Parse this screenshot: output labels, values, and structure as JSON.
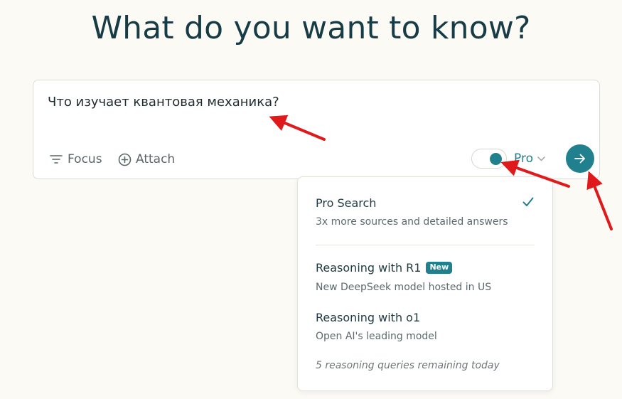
{
  "headline": "What do you want to know?",
  "search": {
    "query": "Что изучает квантовая механика?",
    "focus_label": "Focus",
    "attach_label": "Attach",
    "mode_label": "Pro",
    "pro_toggle_on": true
  },
  "dropdown": {
    "options": [
      {
        "title": "Pro Search",
        "description": "3x more sources and detailed answers",
        "selected": true
      },
      {
        "title": "Reasoning with R1",
        "badge": "New",
        "description": "New DeepSeek model hosted in US"
      },
      {
        "title": "Reasoning with o1",
        "description": "Open AI's leading model"
      }
    ],
    "remaining_note": "5 reasoning queries remaining today"
  },
  "colors": {
    "accent": "#20808d",
    "background": "#fbfaf5",
    "annotation": "#e0191b"
  },
  "icons": [
    "filter-icon",
    "plus-circle-icon",
    "chevron-down-icon",
    "arrow-right-icon",
    "check-icon"
  ]
}
